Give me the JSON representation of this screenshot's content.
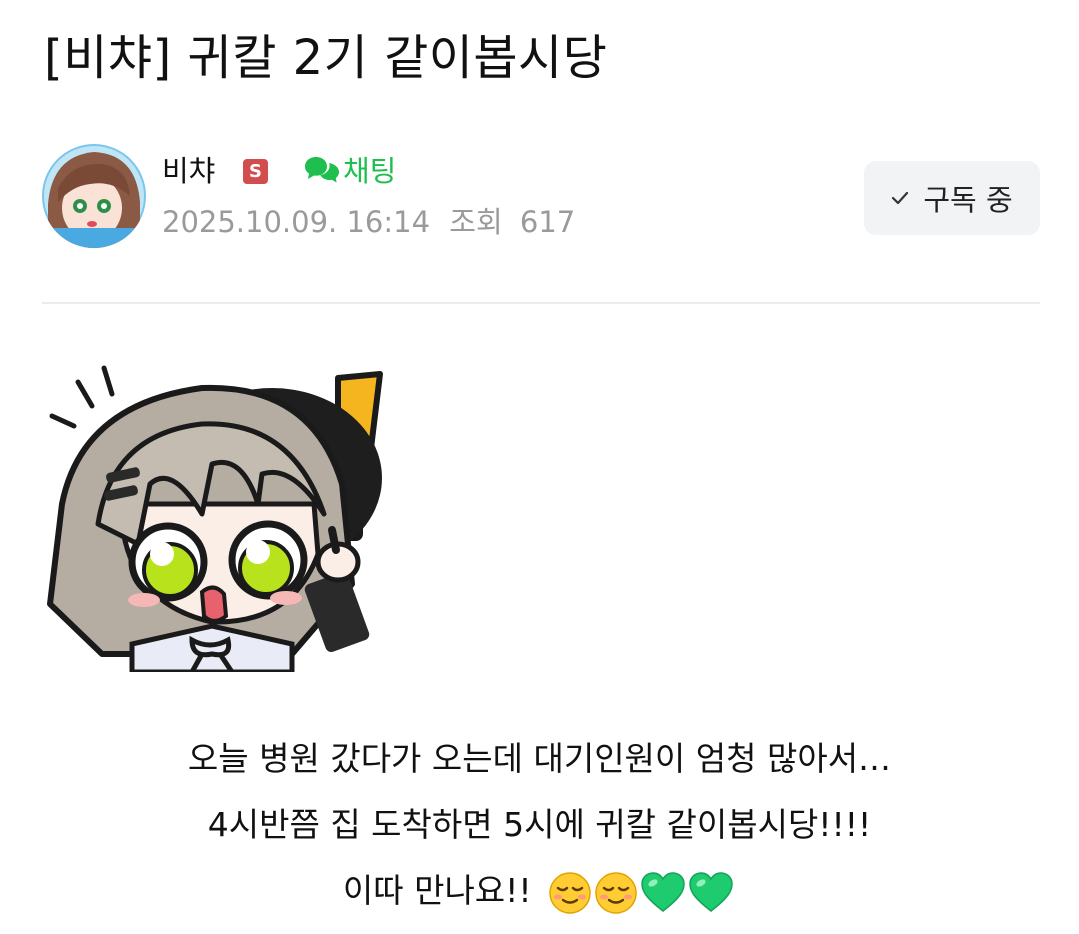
{
  "post": {
    "title": "[비챠] 귀칼 2기 같이봅시당"
  },
  "author": {
    "name": "비챠",
    "badge": "S",
    "chat_label": "채팅",
    "date": "2025.10.09. 16:14",
    "views_label": "조회",
    "views": "617",
    "subscribe_label": "구독 중"
  },
  "body": {
    "line1": "오늘 병원 갔다가 오는데 대기인원이 엄청 많아서…",
    "line2": "4시반쯤 집 도착하면 5시에 귀칼 같이봅시당!!!!",
    "line3": "이따 만나요!!"
  },
  "icons": {
    "check": "check-icon",
    "chat": "chat-bubble-icon",
    "emojis": [
      "relieved-face-icon",
      "relieved-face-icon",
      "green-heart-icon",
      "green-heart-icon"
    ]
  },
  "colors": {
    "accent_green": "#1fbf4f",
    "badge_red": "#d24d4d",
    "meta_gray": "#9a9a9a",
    "button_bg": "#f2f3f5"
  }
}
